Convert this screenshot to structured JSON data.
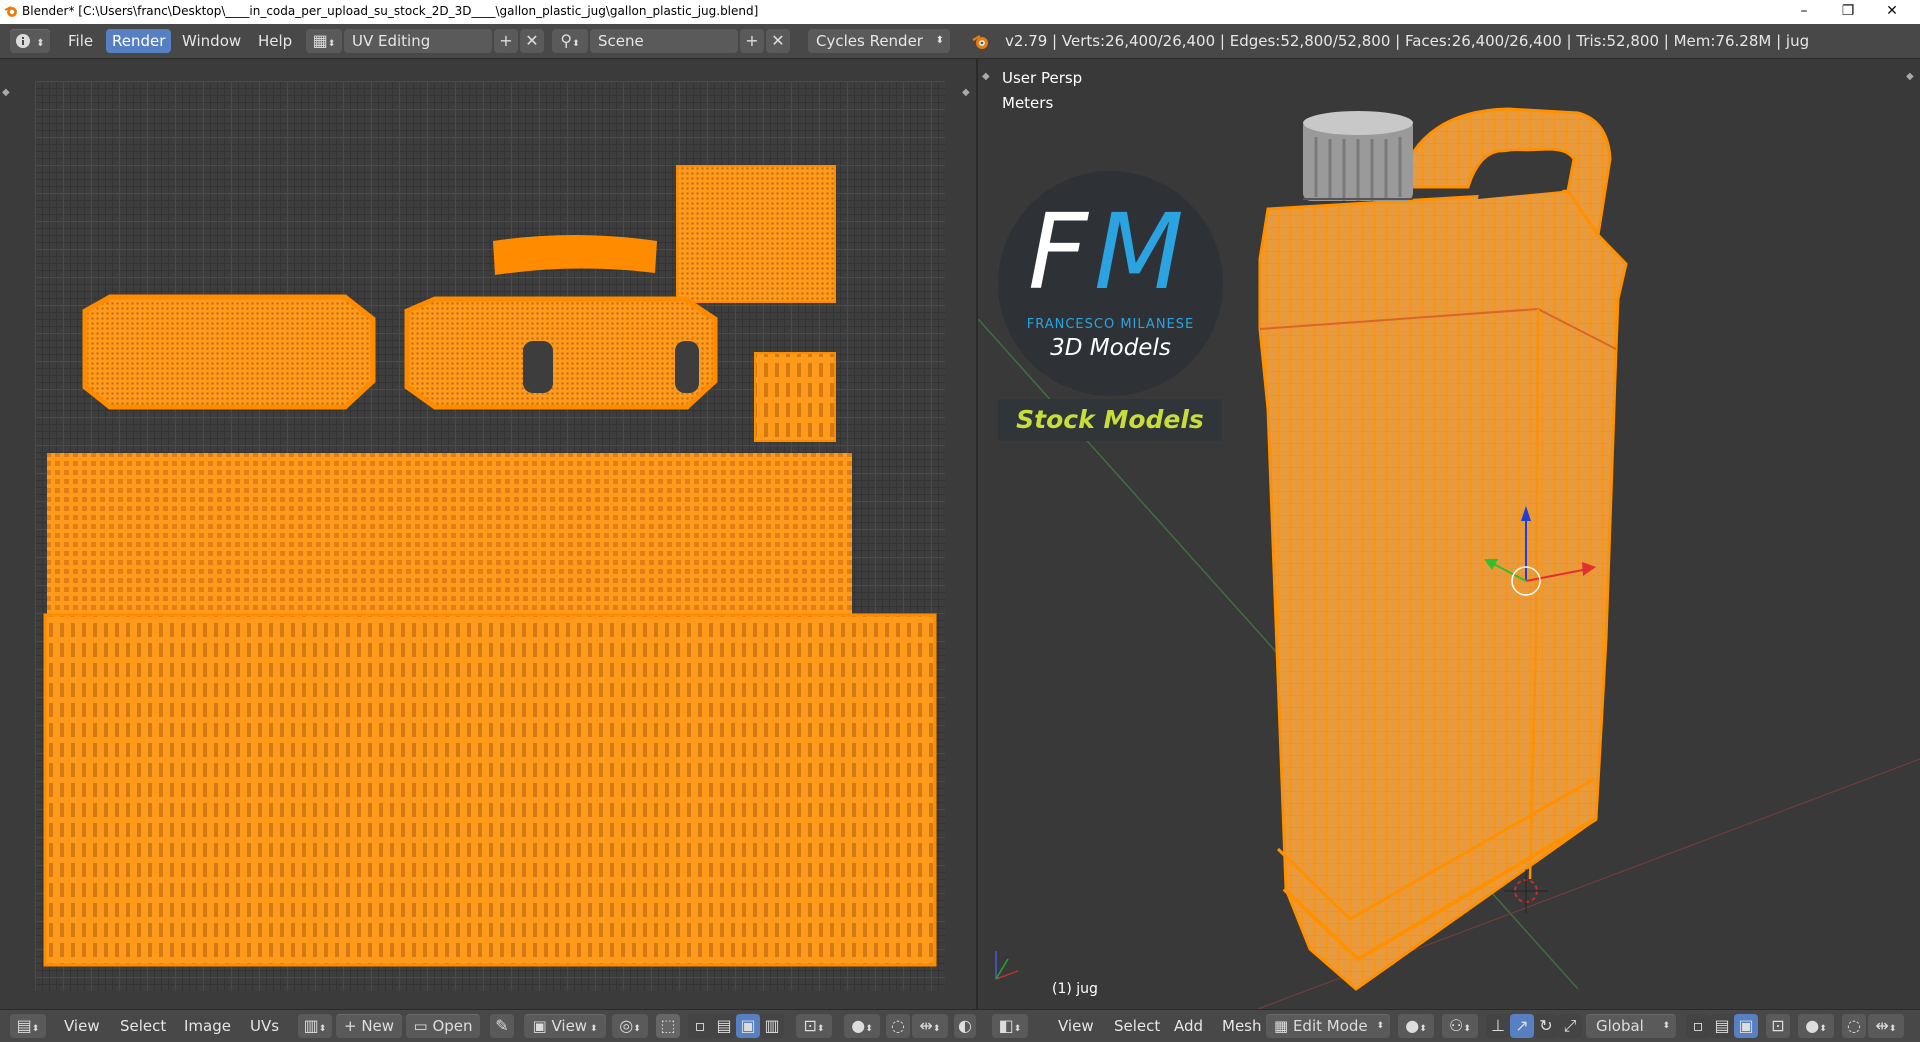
{
  "window": {
    "title": "Blender* [C:\\Users\\franc\\Desktop\\____in_coda_per_upload_su_stock_2D_3D____\\gallon_plastic_jug\\gallon_plastic_jug.blend]",
    "controls": [
      "–",
      "❐",
      "✕"
    ]
  },
  "header": {
    "info_icon": "info-icon",
    "menus": [
      "File",
      "Render",
      "Window",
      "Help"
    ],
    "active_menu": "Render",
    "layout": "UV Editing",
    "scene": "Scene",
    "engine": "Cycles Render",
    "stats": "v2.79 | Verts:26,400/26,400 | Edges:52,800/52,800 | Faces:26,400/26,400 | Tris:52,800 | Mem:76.28M | jug"
  },
  "viewport": {
    "view_name": "User Persp",
    "units": "Meters",
    "object_label": "(1) jug",
    "logo": {
      "letters_f": "F",
      "letters_m": "M",
      "name": "FRANCESCO MILANESE",
      "subtitle": "3D Models",
      "banner": "Stock Models"
    }
  },
  "uv_footer": {
    "menus": [
      "View",
      "Select",
      "Image",
      "UVs"
    ],
    "new_label": "New",
    "open_label": "Open",
    "view_label": "View"
  },
  "vp_footer": {
    "menus": [
      "View",
      "Select",
      "Add",
      "Mesh"
    ],
    "mode": "Edit Mode",
    "orientation": "Global"
  },
  "colors": {
    "accent": "#ff8c00",
    "wire": "#ffa32a",
    "active_menu": "#5680c2",
    "logo_blue": "#2aa3e0",
    "banner_text": "#c8dc3a"
  }
}
